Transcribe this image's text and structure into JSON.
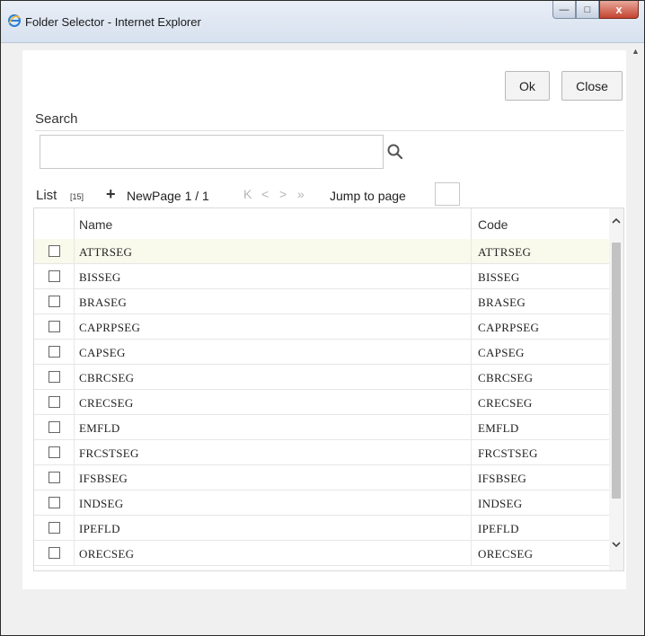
{
  "window": {
    "title": "Folder Selector - Internet Explorer",
    "close_glyph": "x",
    "minimize_glyph": "—",
    "maximize_glyph": "□"
  },
  "toolbar": {
    "ok_label": "Ok",
    "close_label": "Close"
  },
  "search": {
    "label": "Search",
    "value": "",
    "placeholder": ""
  },
  "list": {
    "label": "List",
    "count": "[15]",
    "new_label": "New",
    "page_info": "Page 1 / 1",
    "pager_first": "K",
    "pager_prev": "<",
    "pager_next": ">",
    "pager_last": "»",
    "jump_label": "Jump to page",
    "jump_value": ""
  },
  "grid": {
    "columns": [
      "Name",
      "Code"
    ],
    "rows": [
      {
        "name": "ATTRSEG",
        "code": "ATTRSEG",
        "selected": true
      },
      {
        "name": "BISSEG",
        "code": "BISSEG"
      },
      {
        "name": "BRASEG",
        "code": "BRASEG"
      },
      {
        "name": "CAPRPSEG",
        "code": "CAPRPSEG"
      },
      {
        "name": "CAPSEG",
        "code": "CAPSEG"
      },
      {
        "name": "CBRCSEG",
        "code": "CBRCSEG"
      },
      {
        "name": "CRECSEG",
        "code": "CRECSEG"
      },
      {
        "name": "EMFLD",
        "code": "EMFLD"
      },
      {
        "name": "FRCSTSEG",
        "code": "FRCSTSEG"
      },
      {
        "name": "IFSBSEG",
        "code": "IFSBSEG"
      },
      {
        "name": "INDSEG",
        "code": "INDSEG"
      },
      {
        "name": "IPEFLD",
        "code": "IPEFLD"
      },
      {
        "name": "ORECSEG",
        "code": "ORECSEG"
      }
    ]
  },
  "colors": {
    "selected_row": "#f9f9ec",
    "close_button": "#c4432f",
    "titlebar": "#dbe4f0"
  },
  "icons": [
    "ie-icon",
    "search-icon",
    "plus-icon",
    "chevron-up-icon",
    "chevron-down-icon"
  ]
}
